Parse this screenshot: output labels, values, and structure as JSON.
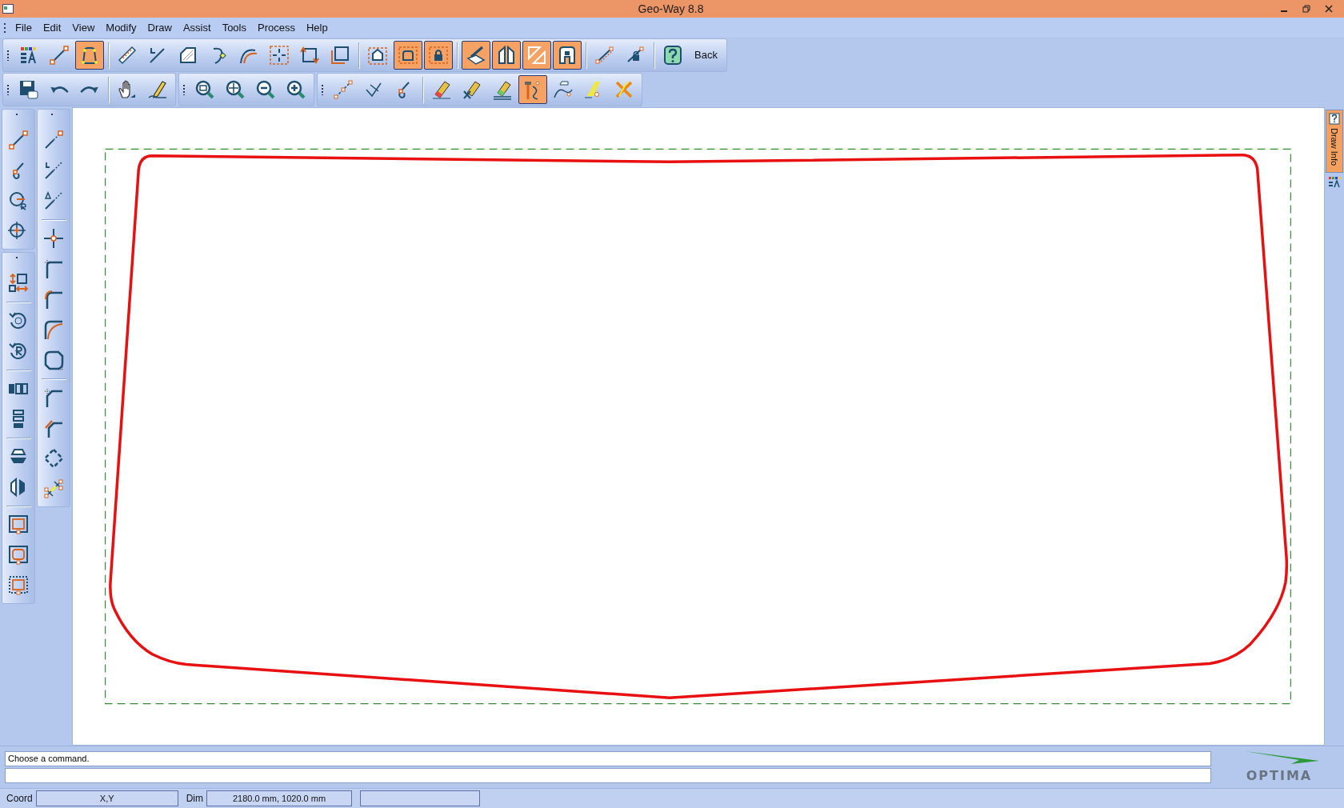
{
  "window": {
    "title": "Geo-Way 8.8"
  },
  "menu": [
    {
      "label": "File"
    },
    {
      "label": "Edit"
    },
    {
      "label": "View"
    },
    {
      "label": "Modify"
    },
    {
      "label": "Draw"
    },
    {
      "label": "Assist"
    },
    {
      "label": "Tools"
    },
    {
      "label": "Process"
    },
    {
      "label": "Help"
    }
  ],
  "toolbar_1": {
    "panels": [
      {
        "groups": [
          [
            {
              "kind": "palette",
              "selected": false
            },
            {
              "kind": "line-points",
              "selected": false
            },
            {
              "kind": "outline",
              "selected": true
            }
          ],
          [
            {
              "kind": "ruler",
              "selected": false
            },
            {
              "kind": "angle",
              "selected": false
            },
            {
              "kind": "bevel",
              "selected": false
            },
            {
              "kind": "curve",
              "selected": false
            },
            {
              "kind": "arc",
              "selected": false
            },
            {
              "kind": "snap-center",
              "selected": false
            },
            {
              "kind": "rect-arrows",
              "selected": false
            },
            {
              "kind": "rect-corner",
              "selected": false
            }
          ],
          [
            {
              "kind": "frame-hand",
              "selected": false
            },
            {
              "kind": "frame-rounded",
              "selected": true
            },
            {
              "kind": "frame-lock",
              "selected": true
            }
          ],
          [
            {
              "kind": "blade",
              "selected": true
            },
            {
              "kind": "mirror",
              "selected": true
            },
            {
              "kind": "flip",
              "selected": true
            },
            {
              "kind": "clamp",
              "selected": true
            }
          ],
          [
            {
              "kind": "sequence",
              "selected": false
            },
            {
              "kind": "sequence-lock",
              "selected": false
            }
          ],
          [
            {
              "kind": "help",
              "selected": false
            },
            {
              "kind": "text",
              "label": "Back",
              "selected": false
            }
          ]
        ]
      }
    ]
  },
  "toolbar_2": {
    "panels": [
      {
        "groups": [
          [
            {
              "kind": "save",
              "selected": false
            },
            {
              "kind": "undo",
              "selected": false
            },
            {
              "kind": "redo",
              "selected": false
            }
          ],
          [
            {
              "kind": "hand",
              "selected": false
            },
            {
              "kind": "pencil",
              "selected": false
            }
          ]
        ]
      },
      {
        "groups": [
          [
            {
              "kind": "zoom-window",
              "selected": false
            },
            {
              "kind": "zoom-pan",
              "selected": false
            },
            {
              "kind": "zoom-out",
              "selected": false
            },
            {
              "kind": "zoom-in",
              "selected": false
            }
          ]
        ]
      },
      {
        "groups": [
          [
            {
              "kind": "break-line",
              "selected": false
            },
            {
              "kind": "cross-lines",
              "selected": false
            },
            {
              "kind": "hook",
              "selected": false
            }
          ],
          [
            {
              "kind": "eraser",
              "selected": false
            },
            {
              "kind": "eraser-x",
              "selected": false
            },
            {
              "kind": "eraser-line",
              "selected": false
            },
            {
              "kind": "drill",
              "selected": true
            },
            {
              "kind": "hand-curve",
              "selected": false
            },
            {
              "kind": "highlighter",
              "selected": false
            },
            {
              "kind": "cross-out",
              "selected": false
            }
          ]
        ]
      }
    ]
  },
  "left_toolbar_1": {
    "panels": [
      {
        "groups": [
          [
            {
              "kind": "line-points",
              "selected": false
            },
            {
              "kind": "hook",
              "selected": false
            },
            {
              "kind": "circle-radius",
              "selected": false
            },
            {
              "kind": "circle-center",
              "selected": false
            }
          ]
        ]
      },
      {
        "groups": [
          [
            {
              "kind": "scale",
              "selected": false
            }
          ],
          [
            {
              "kind": "rotate-90",
              "selected": false
            },
            {
              "kind": "rotate",
              "selected": false
            }
          ],
          [
            {
              "kind": "columns",
              "selected": false
            },
            {
              "kind": "rows",
              "selected": false
            }
          ],
          [
            {
              "kind": "split-h",
              "selected": false
            },
            {
              "kind": "split-v",
              "selected": false
            }
          ],
          [
            {
              "kind": "rect-frame",
              "selected": false
            },
            {
              "kind": "octagon-frame",
              "selected": false
            },
            {
              "kind": "dashed-frame",
              "selected": false
            }
          ]
        ]
      }
    ]
  },
  "left_toolbar_2": {
    "panels": [
      {
        "groups": [
          [
            {
              "kind": "dashed-line",
              "selected": false
            },
            {
              "kind": "dashed-angle",
              "selected": false
            },
            {
              "kind": "dashed-delta",
              "selected": false
            }
          ],
          [
            {
              "kind": "crosshair",
              "selected": false
            },
            {
              "kind": "corner",
              "selected": false
            },
            {
              "kind": "corner-fillet",
              "selected": false
            },
            {
              "kind": "corner-radius",
              "selected": false
            },
            {
              "kind": "rounded-square",
              "selected": false
            }
          ],
          [
            {
              "kind": "corner-chamfer",
              "selected": false
            },
            {
              "kind": "corner-orange",
              "selected": false
            },
            {
              "kind": "diamond",
              "selected": false
            },
            {
              "kind": "node-chain",
              "selected": false
            }
          ]
        ]
      }
    ]
  },
  "side_panel": {
    "tabs": [
      {
        "label": "Draw Info",
        "selected": true
      }
    ]
  },
  "command": {
    "output": "Choose a command.",
    "logo": "OPTIMA"
  },
  "status_bar": {
    "coord_label": "Coord",
    "coord_value": "X,Y",
    "dim_label": "Dim",
    "dim_value": "2180.0 mm, 1020.0 mm"
  }
}
